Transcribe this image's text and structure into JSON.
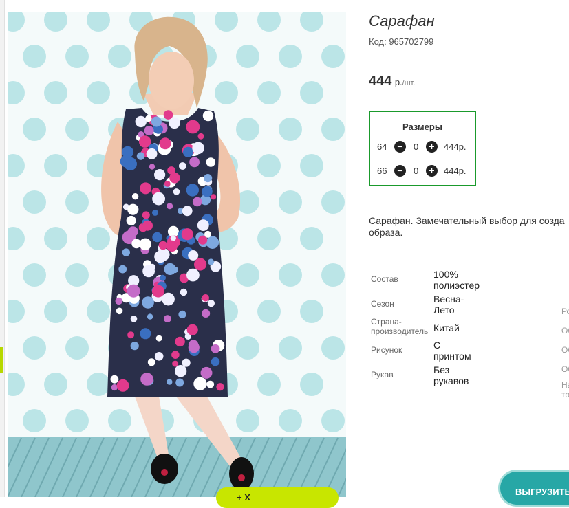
{
  "product": {
    "title": "Сарафан",
    "code": "Код: 965702799",
    "price": "444",
    "currency": "р.",
    "per_unit": "/шт."
  },
  "sizes": {
    "header": "Размеры",
    "rows": [
      {
        "size": "64",
        "qty": "0",
        "price": "444р."
      },
      {
        "size": "66",
        "qty": "0",
        "price": "444р."
      }
    ],
    "minus_icon": "minus-circle-icon",
    "plus_icon": "plus-circle-icon"
  },
  "description": {
    "line1": "Сарафан. Замечательный выбор для созда",
    "line2": "образа."
  },
  "properties": [
    {
      "label": "Состав",
      "value_l1": "100%",
      "value_l2": "полиэстер"
    },
    {
      "label": "Сезон",
      "value_l1": "Весна-",
      "value_l2": "Лето"
    },
    {
      "label_l1": "Страна-",
      "label_l2": "производитель",
      "value_l1": "Китай"
    },
    {
      "label": "Рисунок",
      "value_l1": "С",
      "value_l2": "принтом"
    },
    {
      "label": "Рукав",
      "value_l1": "Без",
      "value_l2": "рукавов"
    }
  ],
  "right_column_fragments": [
    "Ро",
    "Об",
    "Об",
    "Об",
    "На",
    "то"
  ],
  "buttons": {
    "export": "ВЫГРУЗИТЬ",
    "cart": "+ Х"
  },
  "colors": {
    "border_green": "#1a9a2c",
    "export_teal": "#27a7a6",
    "cart_lime": "#c8e600",
    "dot_color": "#a8dde0"
  }
}
